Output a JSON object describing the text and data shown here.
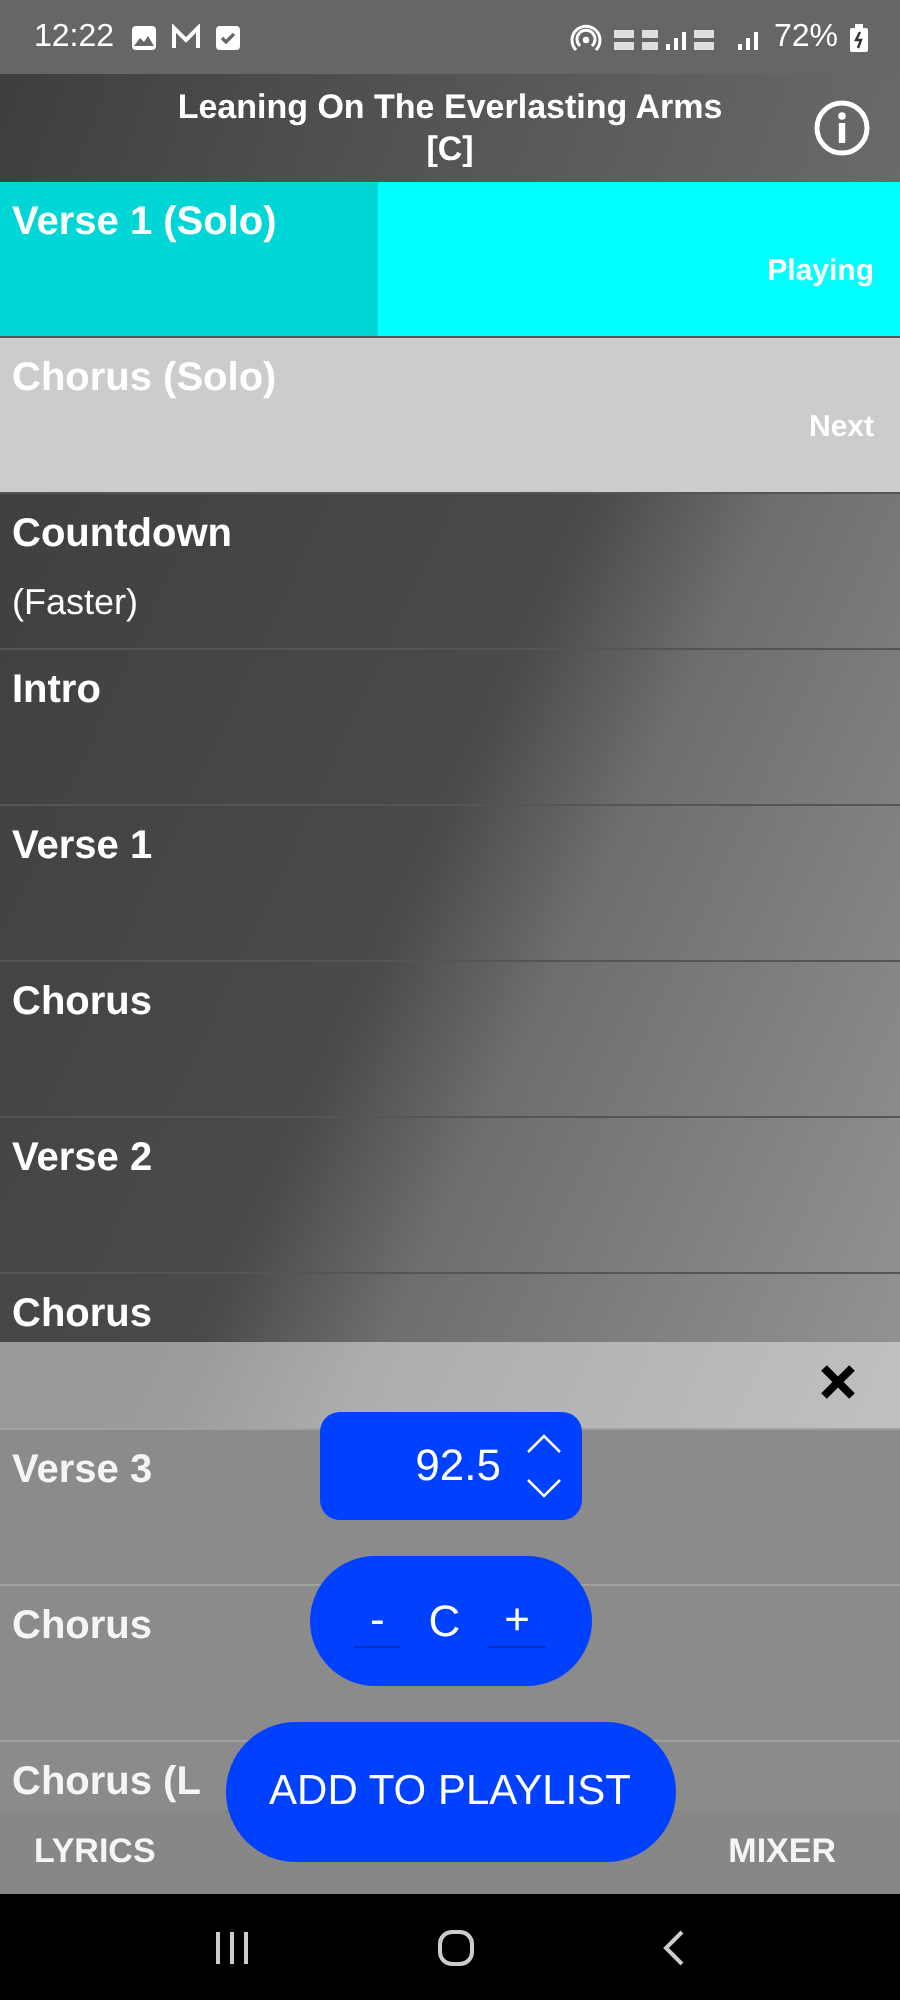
{
  "status_bar": {
    "time": "12:22",
    "battery": "72%"
  },
  "header": {
    "title": "Leaning On The Everlasting Arms",
    "key": "[C]"
  },
  "sections": [
    {
      "name": "Verse 1 (Solo)",
      "kind": "playing",
      "status": "Playing",
      "level": 0.42
    },
    {
      "name": "Chorus (Solo)",
      "kind": "next",
      "status": "Next"
    },
    {
      "name": "Countdown",
      "note": "(Faster)",
      "kind": "plain"
    },
    {
      "name": "Intro",
      "kind": "plain"
    },
    {
      "name": "Verse 1",
      "kind": "plain"
    },
    {
      "name": "Chorus",
      "kind": "plain"
    },
    {
      "name": "Verse 2",
      "kind": "plain"
    },
    {
      "name": "Chorus",
      "kind": "plain"
    },
    {
      "name": "Verse 3",
      "kind": "plain"
    },
    {
      "name": "Chorus",
      "kind": "plain"
    },
    {
      "name": "Chorus (L",
      "kind": "plain"
    }
  ],
  "tabs": [
    {
      "label": "LYRICS"
    },
    {
      "label": "MIXER"
    }
  ],
  "settings_sheet": {
    "tempo": "92.5",
    "key_down": "-",
    "key": "C",
    "key_up": "+",
    "add_button": "ADD TO PLAYLIST"
  }
}
